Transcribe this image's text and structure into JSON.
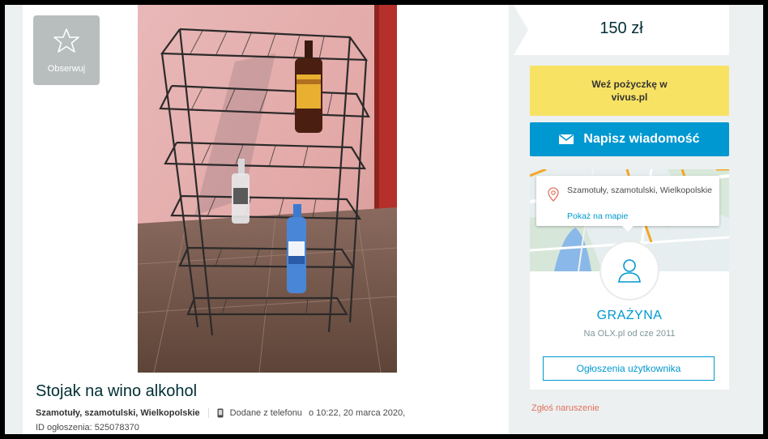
{
  "follow": {
    "label": "Obserwuj",
    "icon": "star-outline-icon"
  },
  "listing": {
    "title": "Stojak na wino alkohol",
    "location": "Szamotuły, szamotulski, Wielkopolskie",
    "added": "Dodane z telefonu",
    "added_time": "o 10:22, 20 marca 2020,",
    "ad_id": "ID ogłoszenia: 525078370"
  },
  "sidebar": {
    "price": "150 zł",
    "loan": "Weź pożyczkę w vivus.pl",
    "message_button": "Napisz wiadomość",
    "map": {
      "address": "Szamotuły, szamotulski, Wielkopolskie",
      "show_map": "Pokaż na mapie"
    },
    "user": {
      "name": "GRAŻYNA",
      "since": "Na OLX.pl od cze 2011",
      "ads_button": "Ogłoszenia użytkownika"
    },
    "report": "Zgłoś naruszenie"
  },
  "colors": {
    "accent": "#0098d0",
    "loan_bg": "#f8e264",
    "report": "#e2725b",
    "page_bg": "#ecf0f1"
  }
}
